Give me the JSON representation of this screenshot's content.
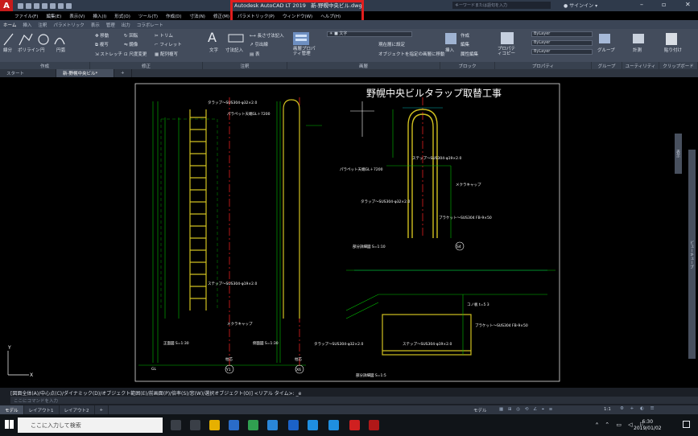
{
  "app": {
    "title": "Autodesk AutoCAD LT 2019",
    "file": "新-野幌中央ビル.dwg",
    "search_placeholder": "キーワードまたは語句を入力",
    "signin": "サインイン",
    "logo": "A"
  },
  "menu": [
    "ファイル(F)",
    "編集(E)",
    "表示(V)",
    "挿入(I)",
    "形式(O)",
    "ツール(T)",
    "作成(D)",
    "寸法(N)",
    "修正(M)",
    "パラメトリック(P)",
    "ウィンドウ(W)",
    "ヘルプ(H)"
  ],
  "ribbon_tabs": [
    "ホーム",
    "挿入",
    "注釈",
    "パラメトリック",
    "表示",
    "管理",
    "出力",
    "コラボレート"
  ],
  "ribbon": {
    "draw": {
      "line": "線分",
      "polyline": "ポリライン",
      "circle": "円",
      "arc": "円弧"
    },
    "modify": {
      "move": "移動",
      "rotate": "回転",
      "trim": "トリム",
      "copy": "複写",
      "mirror": "鏡像",
      "fillet": "フィレット",
      "stretch": "ストレッチ",
      "scale": "尺度変更",
      "array": "配列複写"
    },
    "annotation": {
      "text": "文字",
      "dim": "寸法記入",
      "linear": "長さ寸法記入",
      "leader": "引出線",
      "table": "表"
    },
    "layers": {
      "props": "画層プロパティ管理",
      "current": "文字",
      "set_current": "現在層に設定",
      "match": "オブジェクトを指定の画層に移動"
    },
    "block": {
      "insert": "挿入",
      "create": "作成",
      "edit": "編集",
      "attr": "属性編集"
    },
    "properties": {
      "match": "プロパティコピー",
      "bylayer": "ByLayer"
    },
    "groups": {
      "group": "グループ"
    },
    "utilities": {
      "measure": "計測"
    },
    "clipboard": {
      "paste": "貼り付け"
    }
  },
  "panel_labels": [
    "作成",
    "修正",
    "注釈",
    "画層",
    "ブロック",
    "プロパティ",
    "グループ",
    "ユーティリティ",
    "クリップボード"
  ],
  "doc_tabs": [
    "スタート",
    "新-野幌中央ビル*",
    "+"
  ],
  "drawing": {
    "title": "野幌中央ビルタラップ取替工事",
    "labels": {
      "a1": "タラップ～SUS304-φ32×2.0",
      "a2": "パラペット天端GL＋7200",
      "a3": "ステップ～SUS304-φ19×2.0",
      "a4": "タラップ～SUS304-φ32×2.0",
      "a5": "メクラキャップ",
      "a6": "ブラケット～SUS304 FB-9×50",
      "a7": "部分詳細図 S=1:10",
      "a8": "ステップ～SUS304-φ19×2.0",
      "a9": "メクラキャップ",
      "a10": "正面図 S=1:30",
      "a11": "側面図 S=1:30",
      "a12": "柱芯",
      "a13": "柱芯",
      "a14": "GL",
      "a15": "コノ板 t=5 3",
      "a16": "ブラケット～SUS304 FB-9×50",
      "a17": "タラップ～SUS304-φ32×2.0",
      "a18": "ステップ～SUS304-φ19×2.0",
      "a19": "部分詳細図 S=1:5",
      "a20": "パラペット天端GL＋7200",
      "a21": "Y1",
      "a22": "X6",
      "a23": "S4"
    }
  },
  "command": {
    "history": "[図面全体(A)/中心点(C)/ダイナミック(D)/オブジェクト範囲(E)/前画面(P)/倍率(S)/窓(W)/選択オブジェクト(O)] <リアル タイム>: _e",
    "prompt": "ここにコマンドを入力"
  },
  "layout_tabs": [
    "モデル",
    "レイアウト1",
    "レイアウト2",
    "+"
  ],
  "status": {
    "mode": "モデル",
    "scale": "1:1"
  },
  "taskbar": {
    "search": "ここに入力して検索",
    "time": "6:30",
    "date": "2019/01/02"
  },
  "side_panels": [
    "表示",
    "ビューキューブ"
  ]
}
